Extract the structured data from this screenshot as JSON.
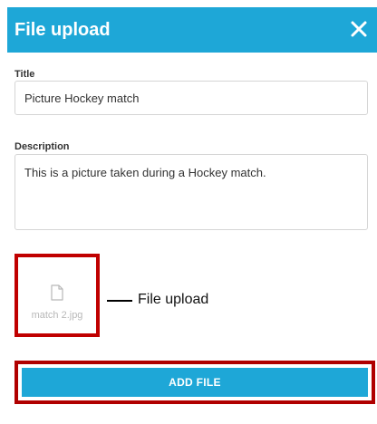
{
  "dialog": {
    "title": "File upload",
    "close_icon": "close-icon"
  },
  "form": {
    "title_label": "Title",
    "title_value": "Picture Hockey match",
    "description_label": "Description",
    "description_value": "This is a picture taken during a Hockey match."
  },
  "upload": {
    "file_icon": "file-icon",
    "file_name": "match 2.jpg",
    "callout": "File upload",
    "add_button_label": "ADD FILE"
  },
  "colors": {
    "accent": "#1ea7d7",
    "highlight": "#c00000",
    "placeholder_text": "#b8b8b8"
  }
}
